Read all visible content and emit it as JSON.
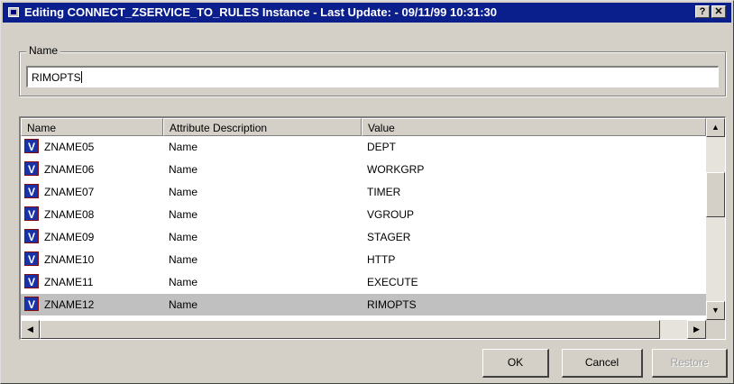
{
  "window": {
    "title": "Editing CONNECT_ZSERVICE_TO_RULES Instance - Last Update: - 09/11/99 10:31:30",
    "help_glyph": "?",
    "close_glyph": "✕"
  },
  "name_group": {
    "label": "Name",
    "value": "RIMOPTS"
  },
  "table": {
    "columns": [
      "Name",
      "Attribute Description",
      "Value"
    ],
    "rows": [
      {
        "icon": "V",
        "name": "ZNAME05",
        "desc": "Name",
        "value": "DEPT"
      },
      {
        "icon": "V",
        "name": "ZNAME06",
        "desc": "Name",
        "value": "WORKGRP"
      },
      {
        "icon": "V",
        "name": "ZNAME07",
        "desc": "Name",
        "value": "TIMER"
      },
      {
        "icon": "V",
        "name": "ZNAME08",
        "desc": "Name",
        "value": "VGROUP"
      },
      {
        "icon": "V",
        "name": "ZNAME09",
        "desc": "Name",
        "value": "STAGER"
      },
      {
        "icon": "V",
        "name": "ZNAME10",
        "desc": "Name",
        "value": "HTTP"
      },
      {
        "icon": "V",
        "name": "ZNAME11",
        "desc": "Name",
        "value": "EXECUTE"
      },
      {
        "icon": "V",
        "name": "ZNAME12",
        "desc": "Name",
        "value": "RIMOPTS"
      }
    ],
    "selected_row": 7
  },
  "buttons": {
    "ok": "OK",
    "cancel": "Cancel",
    "restore": "Restore"
  },
  "icons": {
    "window": "window-icon",
    "row": "v-variable-icon"
  },
  "colors": {
    "titlebar": "#0a1e8c",
    "face": "#d4d0c8",
    "selected_row": "#c0c0c0",
    "row_icon": "#1833a8"
  }
}
